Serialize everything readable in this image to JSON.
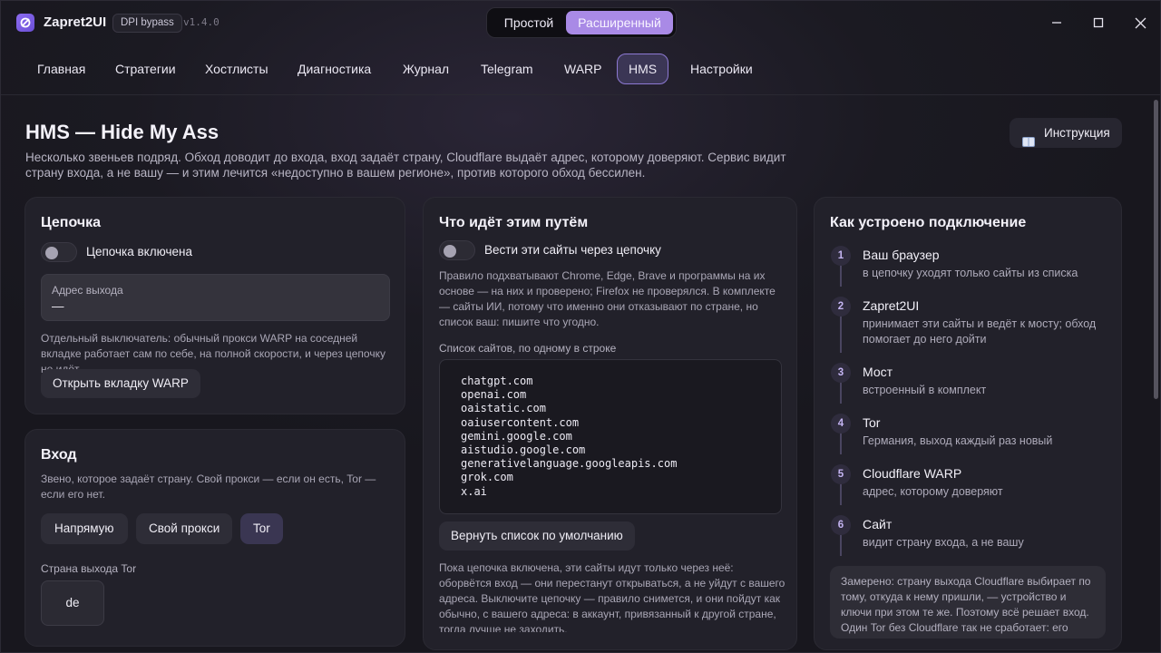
{
  "app": {
    "name": "Zapret2UI",
    "badge": "DPI bypass",
    "version": "v1.4.0"
  },
  "mode": {
    "simple": "Простой",
    "advanced": "Расширенный"
  },
  "nav": [
    "Главная",
    "Стратегии",
    "Хостлисты",
    "Диагностика",
    "Журнал",
    "Telegram",
    "WARP",
    "HMS",
    "Настройки"
  ],
  "nav_active": "HMS",
  "header": {
    "title": "HMS — Hide My Ass",
    "desc": "Несколько звеньев подряд. Обход доводит до входа, вход задаёт страну, Cloudflare выдаёт адрес, которому доверяют. Сервис видит страну входа, а не вашу — и этим лечится «недоступно в вашем регионе», против которого обход бессилен.",
    "help_label": "Инструкция"
  },
  "chain": {
    "title": "Цепочка",
    "toggle_label": "Цепочка включена",
    "exit_label": "Адрес выхода",
    "exit_value": "—",
    "note": "Отдельный выключатель: обычный прокси WARP на соседней вкладке работает сам по себе, на полной скорости, и через цепочку не идёт.",
    "open_warp": "Открыть вкладку WARP"
  },
  "entry": {
    "title": "Вход",
    "desc": "Звено, которое задаёт страну. Свой прокси — если он есть, Tor — если его нет.",
    "options": [
      "Напрямую",
      "Свой прокси",
      "Tor"
    ],
    "selected": "Tor",
    "country_label": "Страна выхода Tor",
    "country_value": "de"
  },
  "route": {
    "title": "Что идёт этим путём",
    "toggle_label": "Вести эти сайты через цепочку",
    "rule_note": "Правило подхватывают Chrome, Edge, Brave и программы на их основе — на них и проверено; Firefox не проверялся. В комплекте — сайты ИИ, потому что именно они отказывают по стране, но список ваш: пишите что угодно.",
    "list_label": "Список сайтов, по одному в строке",
    "sites": [
      "chatgpt.com",
      "openai.com",
      "oaistatic.com",
      "oaiusercontent.com",
      "gemini.google.com",
      "aistudio.google.com",
      "generativelanguage.googleapis.com",
      "grok.com",
      "x.ai"
    ],
    "reset_label": "Вернуть список по умолчанию",
    "warning": "Пока цепочка включена, эти сайты идут только через неё: оборвётся вход — они перестанут открываться, а не уйдут с вашего адреса. Выключите цепочку — правило снимется, и они пойдут как обычно, с вашего адреса: в аккаунт, привязанный к другой стране, тогда лучше не заходить."
  },
  "howto": {
    "title": "Как устроено подключение",
    "steps": [
      {
        "num": "1",
        "title": "Ваш браузер",
        "desc": "в цепочку уходят только сайты из списка"
      },
      {
        "num": "2",
        "title": "Zapret2UI",
        "desc": "принимает эти сайты и ведёт к мосту; обход помогает до него дойти"
      },
      {
        "num": "3",
        "title": "Мост",
        "desc": "встроенный в комплект"
      },
      {
        "num": "4",
        "title": "Tor",
        "desc": "Германия, выход каждый раз новый"
      },
      {
        "num": "5",
        "title": "Cloudflare WARP",
        "desc": "адрес, которому доверяют"
      },
      {
        "num": "6",
        "title": "Сайт",
        "desc": "видит страну входа, а не вашу"
      }
    ],
    "measured": "Замерено: страну выхода Cloudflare выбирает по тому, откуда к нему пришли, — устройство и ключи при этом те же. Поэтому всё решает вход. Один Tor без Cloudflare так не сработает: его"
  },
  "colors": {
    "accent": "#a98ae6",
    "bg": "#1b1a22",
    "card": "#22212a"
  },
  "icons": [
    "app-logo-icon",
    "minimize-icon",
    "maximize-icon",
    "close-icon",
    "book-icon"
  ]
}
